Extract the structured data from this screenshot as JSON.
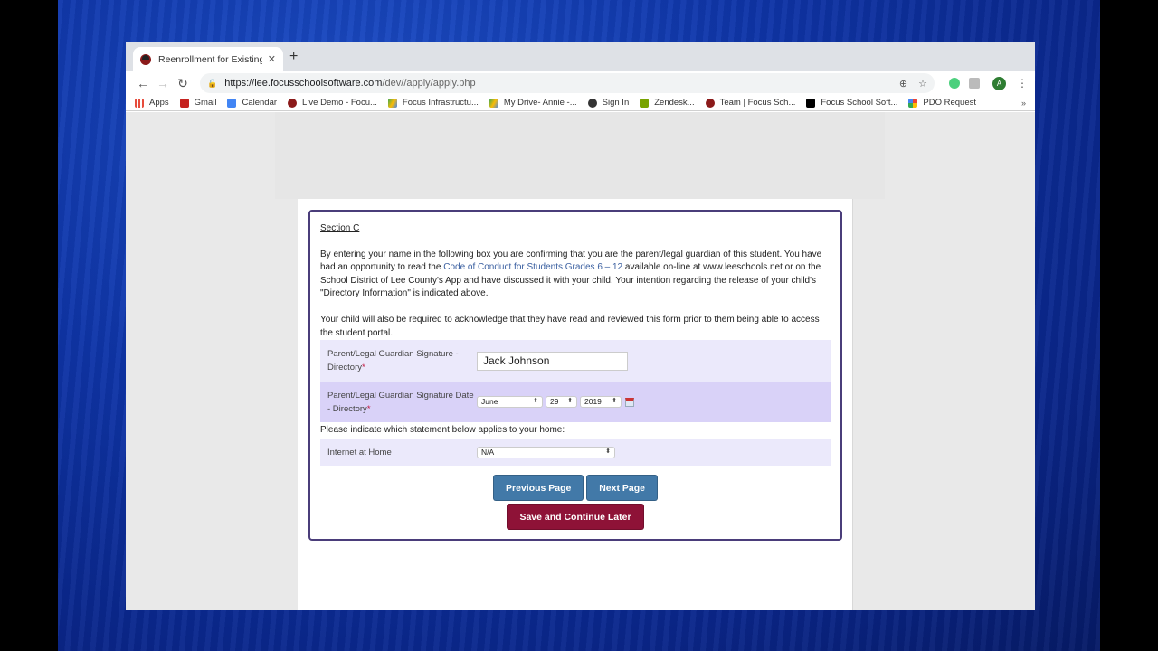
{
  "browser": {
    "tab_title": "Reenrollment for Existing Stude",
    "new_tab_label": "+",
    "url_host": "https://lee.focusschoolsoftware.com",
    "url_path": "/dev//apply/apply.php",
    "avatar_letter": "A",
    "bookmarks": [
      {
        "label": "Apps",
        "color": "#e74c3c"
      },
      {
        "label": "Gmail",
        "color": "#c5221f"
      },
      {
        "label": "Calendar",
        "color": "#4285f4"
      },
      {
        "label": "Live Demo - Focu...",
        "color": "#8b1a1a"
      },
      {
        "label": "Focus Infrastructu...",
        "color": "#34a853"
      },
      {
        "label": "My Drive- Annie -...",
        "color": "#fbbc04"
      },
      {
        "label": "Sign In",
        "color": "#333333"
      },
      {
        "label": "Zendesk...",
        "color": "#78a300"
      },
      {
        "label": "Team | Focus Sch...",
        "color": "#8b1a1a"
      },
      {
        "label": "Focus School Soft...",
        "color": "#000000"
      },
      {
        "label": "PDO Request",
        "color": "#4285f4"
      }
    ],
    "more_bookmarks": "»"
  },
  "form": {
    "section_title": "Section C",
    "para1_a": "By entering your name in the following box you are confirming that you are the parent/legal guardian of this student. You have had an opportunity to read the ",
    "para1_link": "Code of Conduct for Students Grades 6 – 12",
    "para1_b": " available on-line at www.leeschools.net or on the School District of Lee County's App and have discussed it with your child. Your intention regarding the release of your child's \"Directory Information\" is indicated above.",
    "para2": "Your child will also be required to acknowledge that they have read and reviewed this form prior to them being able to access the student portal.",
    "signature_label": "Parent/Legal Guardian Signature - Directory",
    "signature_value": "Jack Johnson",
    "date_label": "Parent/Legal Guardian Signature Date - Directory",
    "date_month": "June",
    "date_day": "29",
    "date_year": "2019",
    "required_mark": "*",
    "question": "Please indicate which statement below applies to your home:",
    "internet_label": "Internet at Home",
    "internet_value": "N/A",
    "prev_button": "Previous Page",
    "next_button": "Next Page",
    "save_button": "Save and Continue Later"
  },
  "colors": {
    "primary_button": "#4279a8",
    "save_button": "#8e1237",
    "card_border": "#4a3d7a",
    "link": "#3a5fa0"
  }
}
